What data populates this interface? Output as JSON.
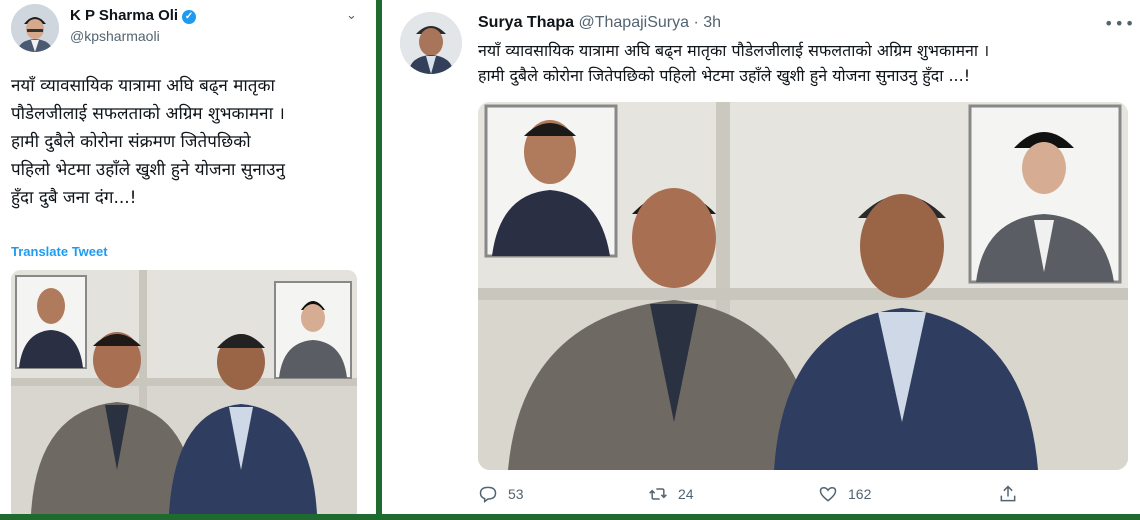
{
  "left_tweet": {
    "author_name": "K P Sharma Oli",
    "handle": "@kpsharmaoli",
    "text_lines": [
      "नयाँ व्यावसायिक यात्रामा अघि बढ्न मातृका",
      "पौडेलजीलाई सफलताको अग्रिम शुभकामना ।",
      "हामी दुबैले कोरोना संक्रमण जितेपछिको",
      "पहिलो भेटमा उहाँले खुशी हुने योजना सुनाउनु",
      "हुँदा दुबै जना दंग...!"
    ],
    "translate_label": "Translate Tweet"
  },
  "right_tweet": {
    "author_name": "Surya Thapa",
    "handle": "@ThapajiSurya",
    "separator": " · ",
    "time": "3h",
    "text_lines": [
      "नयाँ व्यावसायिक यात्रामा अघि बढ्न मातृका पौडेलजीलाई सफलताको अग्रिम शुभकामना ।",
      "हामी दुबैले कोरोना जितेपछिको पहिलो भेटमा उहाँले खुशी हुने योजना सुनाउनु हुँदा ...!"
    ],
    "replies": "53",
    "retweets": "24",
    "likes": "162"
  },
  "colors": {
    "frame_green": "#1f6a2e",
    "link_blue": "#1d9bf0",
    "muted": "#536471"
  }
}
